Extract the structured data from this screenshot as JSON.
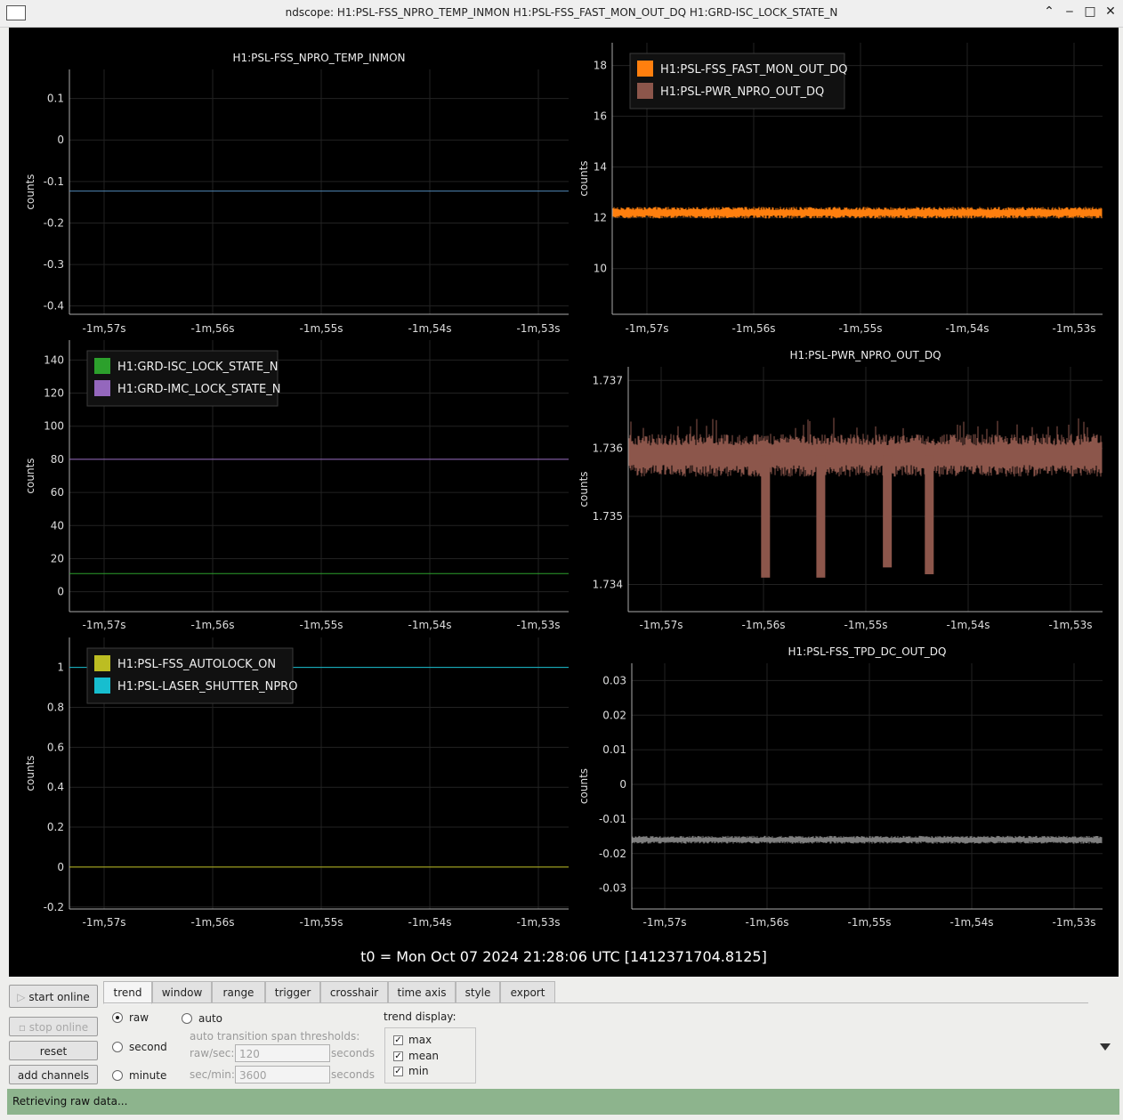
{
  "window": {
    "title": "ndscope: H1:PSL-FSS_NPRO_TEMP_INMON H1:PSL-FSS_FAST_MON_OUT_DQ H1:GRD-ISC_LOCK_STATE_N",
    "buttons": [
      "⌃",
      "‒",
      "□",
      "✕"
    ]
  },
  "t0_label": "t0 = Mon Oct 07 2024 21:28:06 UTC [1412371704.8125]",
  "x_ticks": [
    "-1m,57s",
    "-1m,56s",
    "-1m,55s",
    "-1m,54s",
    "-1m,53s"
  ],
  "chart_data": [
    {
      "type": "line",
      "title": "H1:PSL-FSS_NPRO_TEMP_INMON",
      "ylabel": "counts",
      "yticks": [
        0.1,
        0,
        -0.1,
        -0.2,
        -0.3,
        -0.4
      ],
      "ylim": [
        -0.42,
        0.17
      ],
      "series": [
        {
          "name": "H1:PSL-FSS_NPRO_TEMP_INMON",
          "color": "#4f86b5",
          "values": [
            -0.123
          ]
        }
      ],
      "legend": []
    },
    {
      "type": "line",
      "title": "",
      "ylabel": "counts",
      "yticks": [
        18,
        16,
        14,
        12,
        10
      ],
      "ylim": [
        8.2,
        18.9
      ],
      "series": [
        {
          "name": "H1:PSL-FSS_FAST_MON_OUT_DQ",
          "color": "#ff7f0e",
          "values": [
            12.2
          ]
        }
      ],
      "legend": [
        {
          "name": "H1:PSL-FSS_FAST_MON_OUT_DQ",
          "color": "#ff7f0e"
        },
        {
          "name": "H1:PSL-PWR_NPRO_OUT_DQ",
          "color": "#8c564b"
        }
      ]
    },
    {
      "type": "line",
      "title": "",
      "ylabel": "counts",
      "yticks": [
        140,
        120,
        100,
        80,
        60,
        40,
        20,
        0
      ],
      "ylim": [
        -12,
        152
      ],
      "series": [
        {
          "name": "H1:GRD-ISC_LOCK_STATE_N",
          "color": "#2ca02c",
          "values": [
            11
          ]
        },
        {
          "name": "H1:GRD-IMC_LOCK_STATE_N",
          "color": "#9467bd",
          "values": [
            80
          ]
        }
      ],
      "legend": [
        {
          "name": "H1:GRD-ISC_LOCK_STATE_N",
          "color": "#2ca02c"
        },
        {
          "name": "H1:GRD-IMC_LOCK_STATE_N",
          "color": "#9467bd"
        }
      ]
    },
    {
      "type": "line",
      "title": "H1:PSL-PWR_NPRO_OUT_DQ",
      "ylabel": "counts",
      "yticks": [
        "1.737",
        "1.736",
        "1.735",
        "1.734"
      ],
      "ylim": [
        1.7336,
        1.7372
      ],
      "series": [
        {
          "name": "H1:PSL-PWR_NPRO_OUT_DQ",
          "color": "#8c564b",
          "values": [
            1.7359
          ],
          "dips": [
            {
              "at": -115.98,
              "to": 1.7341
            },
            {
              "at": -115.44,
              "to": 1.7341
            },
            {
              "at": -114.79,
              "to": 1.73425
            },
            {
              "at": -114.38,
              "to": 1.73415
            }
          ]
        }
      ],
      "legend": []
    },
    {
      "type": "line",
      "title": "",
      "ylabel": "counts",
      "yticks": [
        1,
        0.8,
        0.6,
        0.4,
        0.2,
        0,
        -0.2
      ],
      "ylim": [
        -0.21,
        1.15
      ],
      "series": [
        {
          "name": "H1:PSL-FSS_AUTOLOCK_ON",
          "color": "#bcbd22",
          "values": [
            0
          ]
        },
        {
          "name": "H1:PSL-LASER_SHUTTER_NPRO",
          "color": "#17becf",
          "values": [
            1
          ]
        }
      ],
      "legend": [
        {
          "name": "H1:PSL-FSS_AUTOLOCK_ON",
          "color": "#bcbd22"
        },
        {
          "name": "H1:PSL-LASER_SHUTTER_NPRO",
          "color": "#17becf"
        }
      ]
    },
    {
      "type": "line",
      "title": "H1:PSL-FSS_TPD_DC_OUT_DQ",
      "ylabel": "counts",
      "yticks": [
        "0.03",
        "0.02",
        "0.01",
        "0",
        "-0.01",
        "-0.02",
        "-0.03"
      ],
      "ylim": [
        -0.036,
        0.035
      ],
      "series": [
        {
          "name": "H1:PSL-FSS_TPD_DC_OUT_DQ",
          "color": "#7f7f7f",
          "values": [
            -0.016
          ]
        }
      ],
      "legend": []
    }
  ],
  "sidebar": {
    "start_online": "start online",
    "stop_online": "stop online",
    "reset": "reset",
    "add_channels": "add channels"
  },
  "tabs": [
    "trend",
    "window",
    "range",
    "trigger",
    "crosshair",
    "time axis",
    "style",
    "export"
  ],
  "trend": {
    "raw": "raw",
    "second": "second",
    "minute": "minute",
    "auto": "auto",
    "thresholds_label": "auto transition span thresholds:",
    "raw_sec_label": "raw/sec:",
    "raw_sec_value": "120",
    "sec_min_label": "sec/min:",
    "sec_min_value": "3600",
    "seconds": "seconds",
    "display_label": "trend display:",
    "display_options": [
      "max",
      "mean",
      "min"
    ]
  },
  "status": "Retrieving raw data..."
}
